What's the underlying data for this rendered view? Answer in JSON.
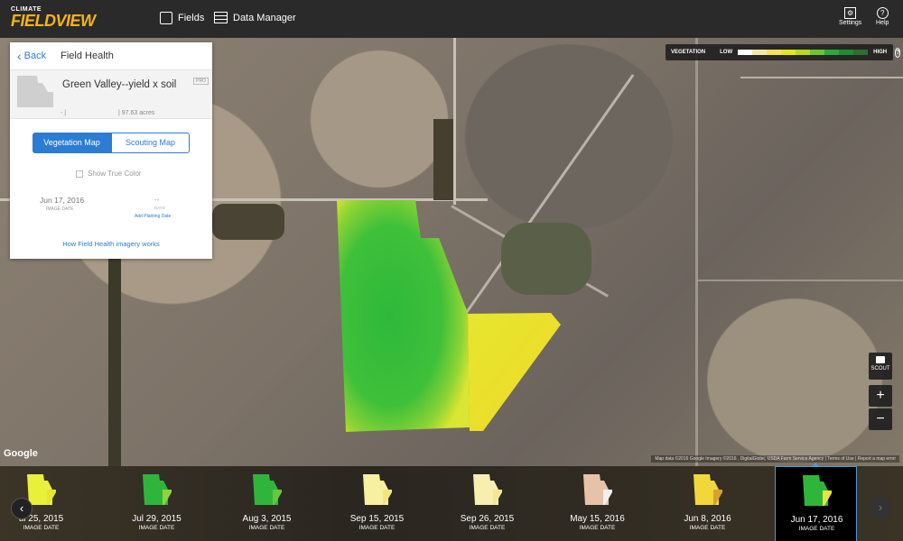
{
  "app": {
    "brand_small": "CLIMATE",
    "brand_big": "FIELDVIEW"
  },
  "nav": {
    "fields_label": "Fields",
    "data_manager_label": "Data Manager"
  },
  "tools": {
    "settings_label": "Settings",
    "help_label": "Help"
  },
  "legend": {
    "title": "VEGETATION",
    "low": "LOW",
    "high": "HIGH",
    "colors": [
      "#ffffff",
      "#f1e9a6",
      "#f3e35a",
      "#e2e81a",
      "#b5dc1a",
      "#6cc62e",
      "#2ea83c",
      "#1f8c2f",
      "#2d6e32"
    ]
  },
  "panel": {
    "back_label": "Back",
    "title": "Field Health",
    "field_name": "Green Valley--yield x soil",
    "field_tag": "PRO",
    "field_meta_left": "- |",
    "field_acres": "|  97.63 acres",
    "tab_vegetation": "Vegetation Map",
    "tab_scouting": "Scouting Map",
    "true_color_label": "Show True Color",
    "image_date": "Jun 17, 2016",
    "image_date_label": "IMAGE DATE",
    "planting_value": "--",
    "planting_sub": "DAYS",
    "planting_link": "Add Planting Date",
    "help_link": "How Field Health imagery works"
  },
  "map": {
    "google": "Google",
    "credits": "Map data ©2016 Google Imagery ©2016 , DigitalGlobe, USDA Farm Service Agency  |  Terms of Use  |  Report a map error",
    "scout_label": "SCOUT",
    "zoom_in": "+",
    "zoom_out": "−"
  },
  "timeline": {
    "items": [
      {
        "date": "ul 25, 2015",
        "label": "IMAGE DATE",
        "c1": "#e8f03a",
        "c2": "#e8e52f"
      },
      {
        "date": "Jul 29, 2015",
        "label": "IMAGE DATE",
        "c1": "#2fb53c",
        "c2": "#8fd43a"
      },
      {
        "date": "Aug 3, 2015",
        "label": "IMAGE DATE",
        "c1": "#2fb53c",
        "c2": "#66c83a"
      },
      {
        "date": "Sep 15, 2015",
        "label": "IMAGE DATE",
        "c1": "#f7f0a0",
        "c2": "#f2e57a"
      },
      {
        "date": "Sep 26, 2015",
        "label": "IMAGE DATE",
        "c1": "#f6efb0",
        "c2": "#f3e890"
      },
      {
        "date": "May 15, 2016",
        "label": "IMAGE DATE",
        "c1": "#e6c3a8",
        "c2": "#f0f0f0"
      },
      {
        "date": "Jun 8, 2016",
        "label": "IMAGE DATE",
        "c1": "#f0d83a",
        "c2": "#d8a12a"
      },
      {
        "date": "Jun 17, 2016",
        "label": "IMAGE DATE",
        "c1": "#2fb53c",
        "c2": "#e9e43a"
      }
    ]
  }
}
